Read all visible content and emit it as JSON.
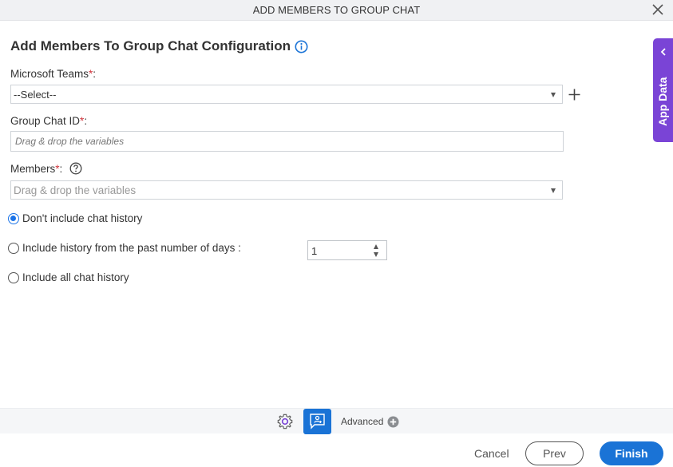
{
  "dialog": {
    "title": "ADD MEMBERS TO GROUP CHAT",
    "close_icon": "close-icon"
  },
  "form": {
    "heading": "Add Members To Group Chat Configuration",
    "info_icon": "info-icon",
    "microsoft_teams": {
      "label": "Microsoft Teams",
      "required": "*",
      "colon": ":",
      "value": "--Select--",
      "add_icon": "plus-icon"
    },
    "group_chat_id": {
      "label": "Group Chat ID",
      "required": "*",
      "colon": ":",
      "placeholder": "Drag & drop the variables"
    },
    "members": {
      "label": "Members",
      "required": "*",
      "colon": ":",
      "placeholder": "Drag & drop the variables",
      "help_icon": "question-circle-icon"
    },
    "history_options": [
      {
        "label": "Don't include chat history",
        "checked": true
      },
      {
        "label": "Include history from the past number of days :",
        "checked": false
      },
      {
        "label": "Include all chat history",
        "checked": false
      }
    ],
    "days_value": "1"
  },
  "side_panel": {
    "label": "App Data",
    "chevron_icon": "chevron-left-icon"
  },
  "toolbar": {
    "settings_icon": "gear-icon",
    "active_icon": "chat-add-member-icon",
    "advanced_label": "Advanced",
    "advanced_icon": "plus-circle-icon"
  },
  "footer": {
    "cancel_label": "Cancel",
    "prev_label": "Prev",
    "finish_label": "Finish"
  },
  "colors": {
    "primary": "#1a73d6",
    "app_data_panel": "#7a44d6",
    "required": "#d0343b"
  }
}
